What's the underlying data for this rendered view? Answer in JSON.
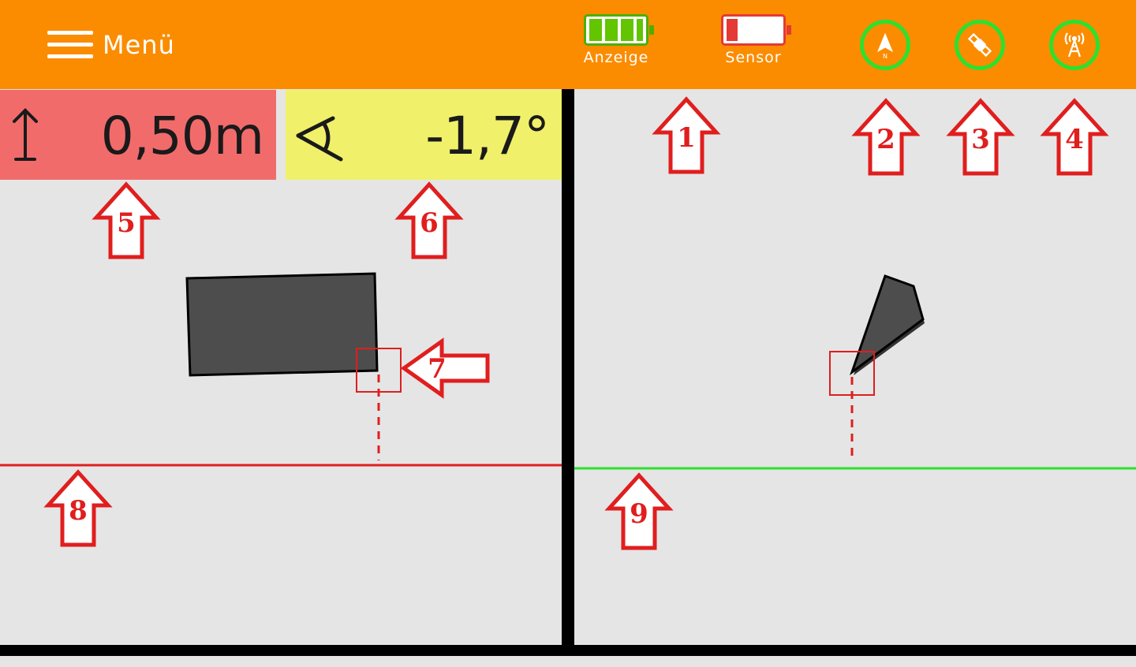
{
  "header": {
    "menu_label": "Menü",
    "display_battery": {
      "label": "Anzeige",
      "level_fraction": 1.0,
      "color": "#4caf00"
    },
    "sensor_battery": {
      "label": "Sensor",
      "level_fraction": 0.15,
      "color": "#e53935"
    },
    "status_icons": [
      "north-arrow-icon",
      "satellite-icon",
      "radio-tower-icon"
    ],
    "status_color": "#2ee02e",
    "background": "#fb8c00"
  },
  "measurements": {
    "height_value": "0,50m",
    "height_color": "#f26b6b",
    "angle_value": "-1,7°",
    "angle_color": "#f0f06a"
  },
  "reference_lines": {
    "left_color": "#e01e1e",
    "right_color": "#2ee02e"
  },
  "annotations": {
    "callouts": [
      "1",
      "2",
      "3",
      "4",
      "5",
      "6",
      "7",
      "8",
      "9"
    ],
    "color": "#e01e1e"
  }
}
